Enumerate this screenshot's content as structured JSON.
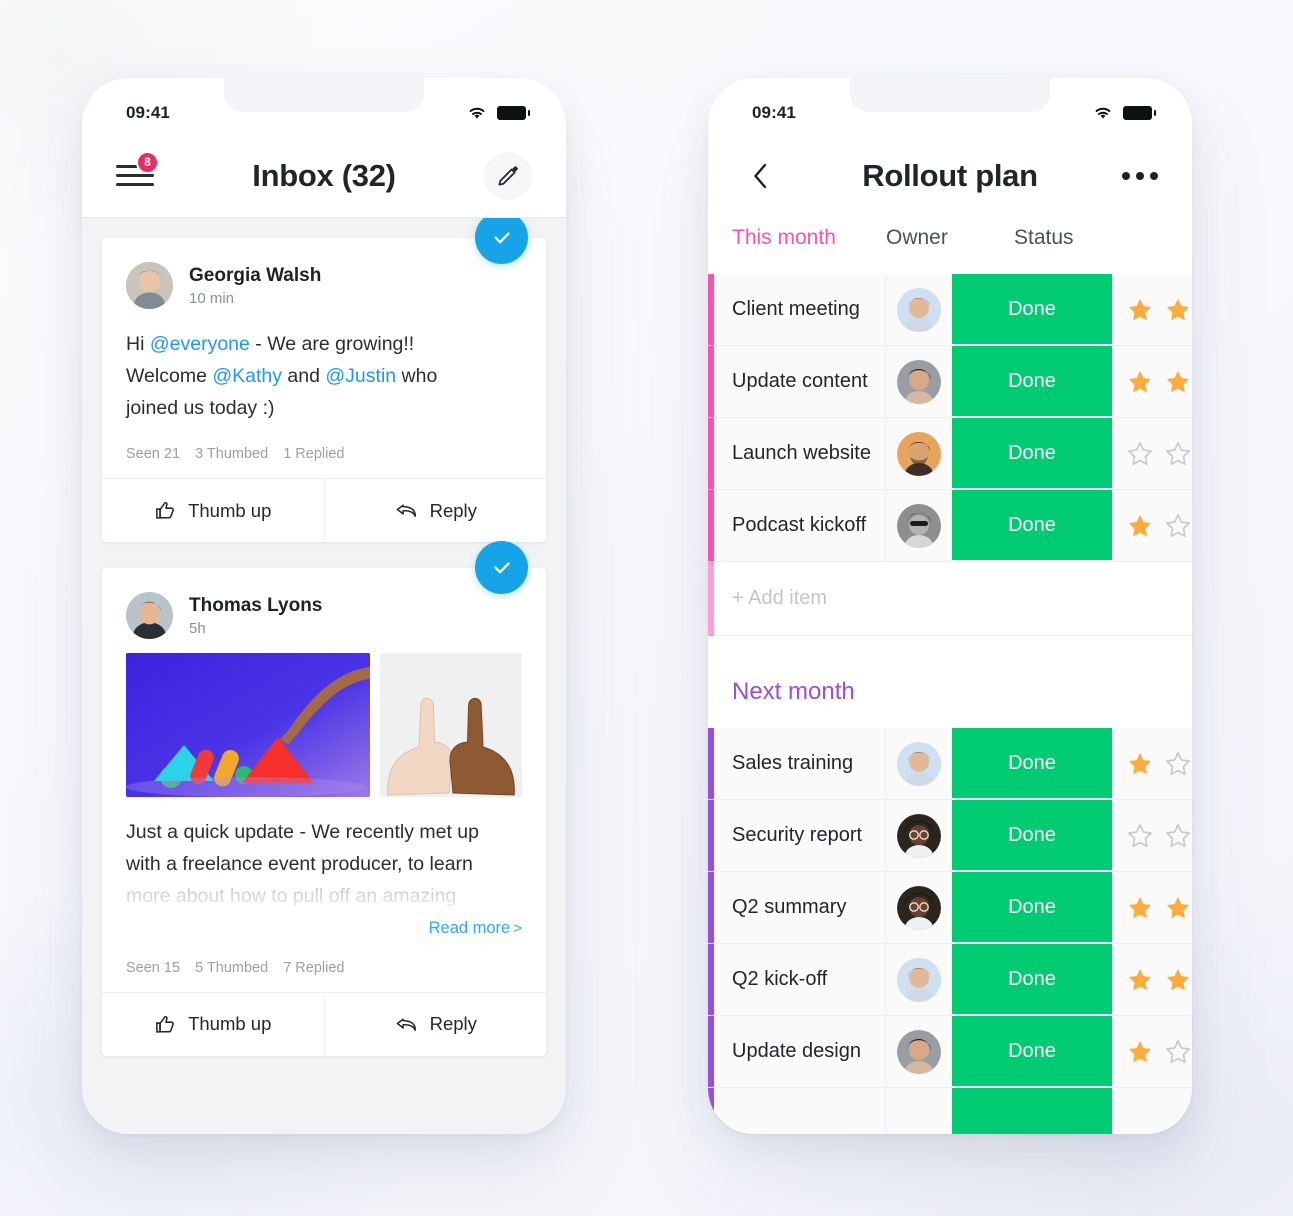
{
  "status_bar": {
    "time": "09:41",
    "wifi_icon": "wifi-icon",
    "battery_icon": "battery-icon"
  },
  "inbox": {
    "menu_icon": "hamburger-menu-icon",
    "menu_badge": "8",
    "title": "Inbox (32)",
    "compose_icon": "pencil-edit-icon",
    "messages": [
      {
        "author": "Georgia Walsh",
        "time": "10 min",
        "text_parts": [
          {
            "t": "Hi ",
            "mention": false
          },
          {
            "t": "@everyone",
            "mention": true
          },
          {
            "t": " - We are growing!!",
            "mention": false
          },
          {
            "t": "\nWelcome ",
            "mention": false
          },
          {
            "t": "@Kathy",
            "mention": true
          },
          {
            "t": " and ",
            "mention": false
          },
          {
            "t": "@Justin",
            "mention": true
          },
          {
            "t": " who",
            "mention": false
          },
          {
            "t": "\njoined us today :)",
            "mention": false
          }
        ],
        "line1_pre": "Hi ",
        "line1_m1": "@everyone",
        "line1_post": " - We are growing!!",
        "line2_pre": "Welcome ",
        "line2_m1": "@Kathy",
        "line2_mid": " and ",
        "line2_m2": "@Justin",
        "line2_post": " who",
        "line3": "joined us today :)",
        "seen": "Seen 21",
        "thumbed": "3 Thumbed",
        "replied": "1 Replied",
        "thumb_label": "Thumb up",
        "reply_label": "Reply",
        "check_icon": "check-circle-icon"
      },
      {
        "author": "Thomas Lyons",
        "time": "5h",
        "line1": "Just a quick update - We recently met up",
        "line2": "with a freelance event producer, to learn",
        "line3_faded": "more about how to pull off an amazing",
        "read_more": "Read more",
        "read_more_chevron": ">",
        "seen": "Seen 15",
        "thumbed": "5 Thumbed",
        "replied": "7 Replied",
        "thumb_label": "Thumb up",
        "reply_label": "Reply",
        "check_icon": "check-circle-icon",
        "media_main_alt": "colored-shapes-photo",
        "media_side_alt": "thumbs-up-hands-photo"
      }
    ]
  },
  "rollout": {
    "back_icon": "chevron-left-icon",
    "title": "Rollout plan",
    "more_icon": "more-options-icon",
    "columns": {
      "title": "This month",
      "owner": "Owner",
      "status": "Status"
    },
    "groups": [
      {
        "name": "This month",
        "color": "#ff4fb0",
        "accent": "pink",
        "is_header_group": true,
        "add_item_label": "+ Add item",
        "rows": [
          {
            "task": "Client meeting",
            "owner_avatar": "avatar-man-blue",
            "status": "Done",
            "stars": [
              true,
              true
            ]
          },
          {
            "task": "Update content",
            "owner_avatar": "avatar-woman-gray",
            "status": "Done",
            "stars": [
              true,
              true
            ]
          },
          {
            "task": "Launch website",
            "owner_avatar": "avatar-man-orange",
            "status": "Done",
            "stars": [
              false,
              false
            ]
          },
          {
            "task": "Podcast kickoff",
            "owner_avatar": "avatar-woman-bw",
            "status": "Done",
            "stars": [
              true,
              false
            ]
          }
        ]
      },
      {
        "name": "Next month",
        "color": "#9b4ddb",
        "accent": "purple",
        "is_header_group": false,
        "rows": [
          {
            "task": "Sales training",
            "owner_avatar": "avatar-man-blue",
            "status": "Done",
            "stars": [
              true,
              false
            ]
          },
          {
            "task": "Security report",
            "owner_avatar": "avatar-woman-dark",
            "status": "Done",
            "stars": [
              false,
              false
            ]
          },
          {
            "task": "Q2 summary",
            "owner_avatar": "avatar-woman-dark",
            "status": "Done",
            "stars": [
              true,
              true
            ]
          },
          {
            "task": "Q2 kick-off",
            "owner_avatar": "avatar-man-blue",
            "status": "Done",
            "stars": [
              true,
              true
            ]
          },
          {
            "task": "Update design",
            "owner_avatar": "avatar-woman-gray",
            "status": "Done",
            "stars": [
              true,
              false
            ]
          }
        ]
      }
    ]
  },
  "colors": {
    "status_green": "#00CA72",
    "pink_accent": "#ff4fb0",
    "purple_accent": "#9b4ddb",
    "blue_fab": "#17A3E8",
    "badge_red": "#e82c64",
    "star_gold": "#FDAB3D",
    "star_empty": "#c7cbd0",
    "mention_blue": "#2196f3",
    "link_blue": "#33a6ef"
  }
}
